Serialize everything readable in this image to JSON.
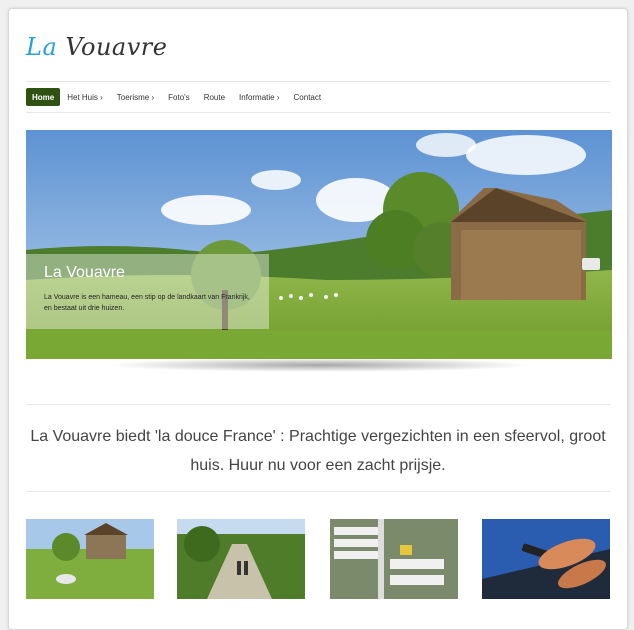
{
  "brand": {
    "la": "La",
    "name": "Vouavre"
  },
  "nav": {
    "items": [
      "Home",
      "Het Huis ›",
      "Toerisme ›",
      "Foto's",
      "Route",
      "Informatie ›",
      "Contact"
    ]
  },
  "hero": {
    "title": "La Vouavre",
    "text": "La Vouavre is een hameau, een stip op de landkaart van Frankrijk, en bestaat uit drie huizen."
  },
  "tagline": "La Vouavre biedt 'la douce France' : Prachtige vergezichten in een sfeervol, groot huis. Huur nu voor een zacht prijsje.",
  "thumbnails": [
    "landscape-photo",
    "walking-path-photo",
    "road-signs-photo",
    "laptop-phone-photo"
  ],
  "colors": {
    "nav_active": "#2f5213",
    "brand_accent": "#2a9fd8"
  }
}
